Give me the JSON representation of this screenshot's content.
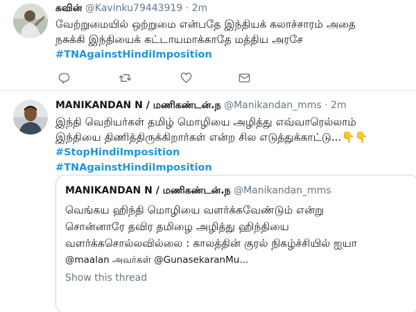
{
  "tweets": [
    {
      "author_name": "கவின்",
      "author_handle": "@Kavinku79443919",
      "separator": "·",
      "time": "2m",
      "text_lines": [
        "வேற்றுமையில் ஒற்றுமை என்பதே இந்தியக் கலாச்சாரம் அதை",
        "நசுக்கி இந்தியைக் கட்டாயமாக்காதே மத்திய அரசே"
      ],
      "hashtags": [
        "#TNAgainstHindiImposition"
      ]
    },
    {
      "author_name": "MANIKANDAN N / மணிகண்டன்.ந",
      "author_handle": "@Manikandan_mms",
      "separator": "·",
      "time": "2m",
      "text_lines": [
        "இந்தி வெறியர்கள் தமிழ் மொழியை அழித்து எவ்வாரெல்லாம்",
        "இந்தியை திணித்திருக்கிறார்கள் என்ற சில எடுத்துக்காட்டு..."
      ],
      "emoji": "👇👇",
      "hashtags": [
        "#StopHindiImposition",
        "#TNAgainstHindiImposition"
      ],
      "quote": {
        "author_name": "MANIKANDAN N / மணிகண்டன்.ந",
        "author_handle": "@Manikandan_mms",
        "text_lines": [
          "வெங்கய ஹிந்தி மொழியை வளர்க்கவேண்டும் என்று",
          "சொன்னாரே தவிர தமிழை அழித்து ஹிந்தியை",
          "வளர்க்கசொல்லவில்லை : காலத்தின் குரல் நிகழ்ச்சியில் ஐயா",
          "@maalan அவர்கள் @GunasekaranMu..."
        ],
        "show_thread": "Show this thread"
      }
    }
  ],
  "icons": {
    "reply": "reply-icon",
    "retweet": "retweet-icon",
    "like": "heart-icon",
    "dm": "envelope-icon"
  },
  "colors": {
    "link": "#1b95e0",
    "muted": "#657786",
    "text": "#14171a",
    "border": "#e6ecf0"
  }
}
